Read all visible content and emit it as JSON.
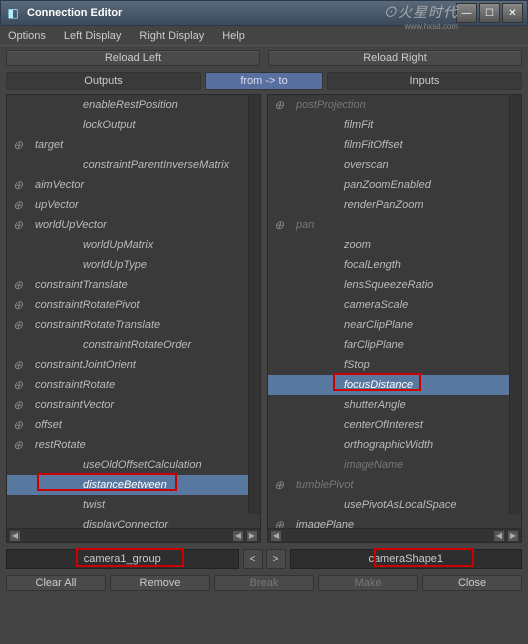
{
  "titlebar": {
    "title": "Connection Editor"
  },
  "watermark": {
    "big": "⊙火星时代",
    "small": "www.hxsd.com"
  },
  "menu": {
    "options": "Options",
    "left_display": "Left Display",
    "right_display": "Right Display",
    "help": "Help"
  },
  "reload": {
    "left": "Reload Left",
    "right": "Reload Right"
  },
  "headers": {
    "outputs": "Outputs",
    "direction": "from -> to",
    "inputs": "Inputs"
  },
  "left_attrs": [
    {
      "label": "enableRestPosition",
      "exp": false,
      "dim": false
    },
    {
      "label": "lockOutput",
      "exp": false,
      "dim": false
    },
    {
      "label": "target",
      "exp": true,
      "dim": false
    },
    {
      "label": "constraintParentInverseMatrix",
      "exp": false,
      "dim": false
    },
    {
      "label": "aimVector",
      "exp": true,
      "dim": false
    },
    {
      "label": "upVector",
      "exp": true,
      "dim": false
    },
    {
      "label": "worldUpVector",
      "exp": true,
      "dim": false
    },
    {
      "label": "worldUpMatrix",
      "exp": false,
      "dim": false
    },
    {
      "label": "worldUpType",
      "exp": false,
      "dim": false
    },
    {
      "label": "constraintTranslate",
      "exp": true,
      "dim": false
    },
    {
      "label": "constraintRotatePivot",
      "exp": true,
      "dim": false
    },
    {
      "label": "constraintRotateTranslate",
      "exp": true,
      "dim": false
    },
    {
      "label": "constraintRotateOrder",
      "exp": false,
      "dim": false
    },
    {
      "label": "constraintJointOrient",
      "exp": true,
      "dim": false
    },
    {
      "label": "constraintRotate",
      "exp": true,
      "dim": false
    },
    {
      "label": "constraintVector",
      "exp": true,
      "dim": false
    },
    {
      "label": "offset",
      "exp": true,
      "dim": false
    },
    {
      "label": "restRotate",
      "exp": true,
      "dim": false
    },
    {
      "label": "useOldOffsetCalculation",
      "exp": false,
      "dim": false
    },
    {
      "label": "distanceBetween",
      "exp": false,
      "dim": false,
      "selected": true
    },
    {
      "label": "twist",
      "exp": false,
      "dim": false
    },
    {
      "label": "displayConnector",
      "exp": false,
      "dim": false
    }
  ],
  "right_attrs": [
    {
      "label": "postProjection",
      "exp": true,
      "dim": true
    },
    {
      "label": "filmFit",
      "exp": false,
      "dim": false
    },
    {
      "label": "filmFitOffset",
      "exp": false,
      "dim": false
    },
    {
      "label": "overscan",
      "exp": false,
      "dim": false
    },
    {
      "label": "panZoomEnabled",
      "exp": false,
      "dim": false
    },
    {
      "label": "renderPanZoom",
      "exp": false,
      "dim": false
    },
    {
      "label": "pan",
      "exp": true,
      "dim": true
    },
    {
      "label": "zoom",
      "exp": false,
      "dim": false
    },
    {
      "label": "focalLength",
      "exp": false,
      "dim": false
    },
    {
      "label": "lensSqueezeRatio",
      "exp": false,
      "dim": false
    },
    {
      "label": "cameraScale",
      "exp": false,
      "dim": false
    },
    {
      "label": "nearClipPlane",
      "exp": false,
      "dim": false
    },
    {
      "label": "farClipPlane",
      "exp": false,
      "dim": false
    },
    {
      "label": "fStop",
      "exp": false,
      "dim": false
    },
    {
      "label": "focusDistance",
      "exp": false,
      "dim": false,
      "selected": true
    },
    {
      "label": "shutterAngle",
      "exp": false,
      "dim": false
    },
    {
      "label": "centerOfInterest",
      "exp": false,
      "dim": false
    },
    {
      "label": "orthographicWidth",
      "exp": false,
      "dim": false
    },
    {
      "label": "imageName",
      "exp": false,
      "dim": true
    },
    {
      "label": "tumblePivot",
      "exp": true,
      "dim": true
    },
    {
      "label": "usePivotAsLocalSpace",
      "exp": false,
      "dim": false
    },
    {
      "label": "imagePlane",
      "exp": true,
      "dim": false
    }
  ],
  "nodes": {
    "left": "camera1_group",
    "right": "cameraShape1",
    "prev": "<",
    "next": ">"
  },
  "footer": {
    "clear_all": "Clear All",
    "remove": "Remove",
    "break": "Break",
    "make": "Make",
    "close": "Close"
  }
}
